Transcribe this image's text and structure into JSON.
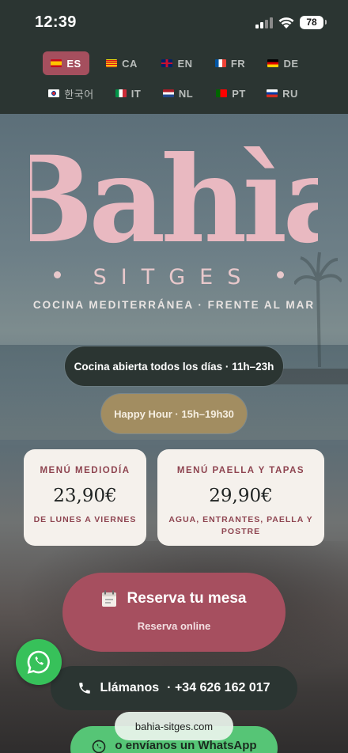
{
  "status_bar": {
    "time": "12:39",
    "battery": "78"
  },
  "languages": [
    {
      "code": "ES",
      "flag": [
        "#c60b1e",
        "#ffc400",
        "#c60b1e"
      ],
      "active": true
    },
    {
      "code": "CA",
      "flag": [
        "#fcdd09",
        "#da121a",
        "#fcdd09"
      ],
      "active": false
    },
    {
      "code": "EN",
      "flag": [
        "#012169",
        "#c8102e",
        "#012169"
      ],
      "active": false
    },
    {
      "code": "FR",
      "flag": [
        "#0055a4",
        "#ffffff",
        "#ef4135"
      ],
      "active": false
    },
    {
      "code": "DE",
      "flag": [
        "#000000",
        "#dd0000",
        "#ffce00"
      ],
      "active": false
    },
    {
      "code": "한국어",
      "flag": [
        "#ffffff",
        "#cd2e3a",
        "#ffffff"
      ],
      "active": false
    },
    {
      "code": "IT",
      "flag": [
        "#009246",
        "#ffffff",
        "#ce2b37"
      ],
      "active": false
    },
    {
      "code": "NL",
      "flag": [
        "#ae1c28",
        "#ffffff",
        "#21468b"
      ],
      "active": false
    },
    {
      "code": "PT",
      "flag": [
        "#006600",
        "#ff0000",
        "#ff0000"
      ],
      "active": false
    },
    {
      "code": "RU",
      "flag": [
        "#ffffff",
        "#0039a6",
        "#d52b1e"
      ],
      "active": false
    }
  ],
  "brand": {
    "logo": "Bahìa",
    "subtitle": "SITGES",
    "tagline": "COCINA MEDITERRÁNEA · FRENTE AL MAR"
  },
  "hours": {
    "kitchen": "Cocina abierta todos los días · 11h–23h",
    "happy_hour": "Happy Hour · 15h–19h30"
  },
  "menus": [
    {
      "title": "MENÚ MEDIODÍA",
      "price": "23,90€",
      "detail": "DE LUNES A VIERNES"
    },
    {
      "title": "MENÚ PAELLA Y TAPAS",
      "price": "29,90€",
      "detail": "AGUA, ENTRANTES, PAELLA Y POSTRE"
    }
  ],
  "reserve": {
    "label": "Reserva tu mesa",
    "sub": "Reserva online"
  },
  "call": {
    "label": "Llámanos",
    "number": "· +34 626 162 017"
  },
  "whatsapp": {
    "label": "o envíanos un WhatsApp"
  },
  "browser": {
    "url": "bahia-sitges.com"
  },
  "colors": {
    "brand_pink": "#e9b9c1",
    "primary": "#a64f5f",
    "dark": "#2b3532",
    "gold": "#a28d61",
    "whatsapp": "#37c15a"
  }
}
